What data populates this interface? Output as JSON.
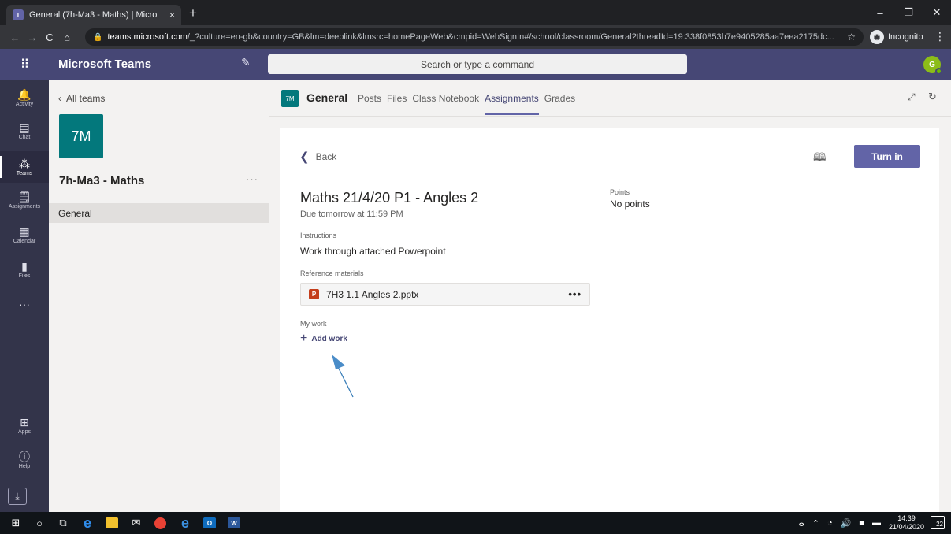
{
  "browser": {
    "tab_title": "General (7h-Ma3 - Maths) | Micro",
    "tab_close": "×",
    "new_tab": "+",
    "url_host": "teams.microsoft.com",
    "url_path": "/_?culture=en-gb&country=GB&lm=deeplink&lmsrc=homePageWeb&cmpid=WebSignIn#/school/classroom/General?threadId=19:338f0853b7e9405285aa7eea2175dc...",
    "profile_label": "Incognito",
    "window_controls": {
      "minimize": "–",
      "maximize": "❐",
      "close": "✕"
    }
  },
  "teams": {
    "app_name": "Microsoft Teams",
    "search_placeholder": "Search or type a command",
    "avatar_initial": "G"
  },
  "rail": {
    "items": [
      {
        "label": "Activity",
        "icon": "bell-icon",
        "glyph": "🔔"
      },
      {
        "label": "Chat",
        "icon": "chat-icon",
        "glyph": "▤"
      },
      {
        "label": "Teams",
        "icon": "teams-icon",
        "glyph": "⁂"
      },
      {
        "label": "Assignments",
        "icon": "assignments-icon",
        "glyph": "🗒"
      },
      {
        "label": "Calendar",
        "icon": "calendar-icon",
        "glyph": "▦"
      },
      {
        "label": "Files",
        "icon": "files-icon",
        "glyph": "▮"
      },
      {
        "label": "",
        "icon": "more-apps-icon",
        "glyph": "···"
      }
    ],
    "bottom": [
      {
        "label": "Apps",
        "icon": "apps-icon",
        "glyph": "⊞"
      },
      {
        "label": "Help",
        "icon": "help-icon",
        "glyph": "?"
      }
    ],
    "active": "Teams"
  },
  "team_panel": {
    "back_label": "All teams",
    "team_tile": "7M",
    "team_name": "7h-Ma3 - Maths",
    "more": "···",
    "channels": [
      "General"
    ]
  },
  "channel": {
    "tile": "7M",
    "name": "General",
    "tabs": [
      "Posts",
      "Files",
      "Class Notebook",
      "Assignments",
      "Grades"
    ],
    "active_tab": "Assignments"
  },
  "assignment": {
    "back_label": "Back",
    "turn_in_label": "Turn in",
    "title": "Maths 21/4/20 P1 - Angles 2",
    "due": "Due tomorrow at 11:59 PM",
    "points_label": "Points",
    "points_value": "No points",
    "instructions_label": "Instructions",
    "instructions_text": "Work through attached Powerpoint",
    "reference_label": "Reference materials",
    "reference_file": "7H3 1.1 Angles 2.pptx",
    "reference_more": "•••",
    "my_work_label": "My work",
    "add_work_label": "Add work"
  },
  "taskbar": {
    "time": "14:39",
    "date": "21/04/2020",
    "notification_count": "22"
  },
  "colors": {
    "teams_purple": "#6264a7",
    "header": "#464775",
    "rail": "#33344a",
    "team_tile": "#03787c"
  }
}
